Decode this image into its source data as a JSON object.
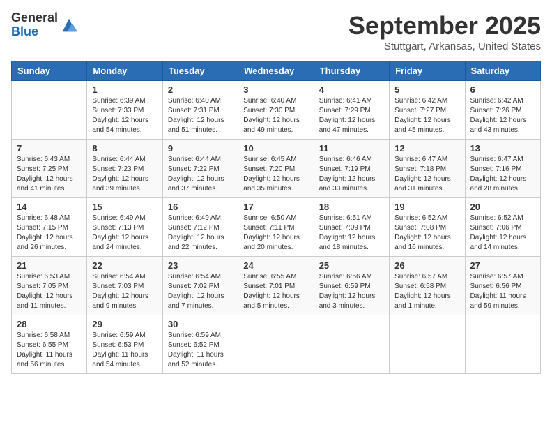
{
  "logo": {
    "general": "General",
    "blue": "Blue"
  },
  "header": {
    "month": "September 2025",
    "location": "Stuttgart, Arkansas, United States"
  },
  "weekdays": [
    "Sunday",
    "Monday",
    "Tuesday",
    "Wednesday",
    "Thursday",
    "Friday",
    "Saturday"
  ],
  "weeks": [
    [
      {
        "day": "",
        "sunrise": "",
        "sunset": "",
        "daylight": ""
      },
      {
        "day": "1",
        "sunrise": "Sunrise: 6:39 AM",
        "sunset": "Sunset: 7:33 PM",
        "daylight": "Daylight: 12 hours and 54 minutes."
      },
      {
        "day": "2",
        "sunrise": "Sunrise: 6:40 AM",
        "sunset": "Sunset: 7:31 PM",
        "daylight": "Daylight: 12 hours and 51 minutes."
      },
      {
        "day": "3",
        "sunrise": "Sunrise: 6:40 AM",
        "sunset": "Sunset: 7:30 PM",
        "daylight": "Daylight: 12 hours and 49 minutes."
      },
      {
        "day": "4",
        "sunrise": "Sunrise: 6:41 AM",
        "sunset": "Sunset: 7:29 PM",
        "daylight": "Daylight: 12 hours and 47 minutes."
      },
      {
        "day": "5",
        "sunrise": "Sunrise: 6:42 AM",
        "sunset": "Sunset: 7:27 PM",
        "daylight": "Daylight: 12 hours and 45 minutes."
      },
      {
        "day": "6",
        "sunrise": "Sunrise: 6:42 AM",
        "sunset": "Sunset: 7:26 PM",
        "daylight": "Daylight: 12 hours and 43 minutes."
      }
    ],
    [
      {
        "day": "7",
        "sunrise": "Sunrise: 6:43 AM",
        "sunset": "Sunset: 7:25 PM",
        "daylight": "Daylight: 12 hours and 41 minutes."
      },
      {
        "day": "8",
        "sunrise": "Sunrise: 6:44 AM",
        "sunset": "Sunset: 7:23 PM",
        "daylight": "Daylight: 12 hours and 39 minutes."
      },
      {
        "day": "9",
        "sunrise": "Sunrise: 6:44 AM",
        "sunset": "Sunset: 7:22 PM",
        "daylight": "Daylight: 12 hours and 37 minutes."
      },
      {
        "day": "10",
        "sunrise": "Sunrise: 6:45 AM",
        "sunset": "Sunset: 7:20 PM",
        "daylight": "Daylight: 12 hours and 35 minutes."
      },
      {
        "day": "11",
        "sunrise": "Sunrise: 6:46 AM",
        "sunset": "Sunset: 7:19 PM",
        "daylight": "Daylight: 12 hours and 33 minutes."
      },
      {
        "day": "12",
        "sunrise": "Sunrise: 6:47 AM",
        "sunset": "Sunset: 7:18 PM",
        "daylight": "Daylight: 12 hours and 31 minutes."
      },
      {
        "day": "13",
        "sunrise": "Sunrise: 6:47 AM",
        "sunset": "Sunset: 7:16 PM",
        "daylight": "Daylight: 12 hours and 28 minutes."
      }
    ],
    [
      {
        "day": "14",
        "sunrise": "Sunrise: 6:48 AM",
        "sunset": "Sunset: 7:15 PM",
        "daylight": "Daylight: 12 hours and 26 minutes."
      },
      {
        "day": "15",
        "sunrise": "Sunrise: 6:49 AM",
        "sunset": "Sunset: 7:13 PM",
        "daylight": "Daylight: 12 hours and 24 minutes."
      },
      {
        "day": "16",
        "sunrise": "Sunrise: 6:49 AM",
        "sunset": "Sunset: 7:12 PM",
        "daylight": "Daylight: 12 hours and 22 minutes."
      },
      {
        "day": "17",
        "sunrise": "Sunrise: 6:50 AM",
        "sunset": "Sunset: 7:11 PM",
        "daylight": "Daylight: 12 hours and 20 minutes."
      },
      {
        "day": "18",
        "sunrise": "Sunrise: 6:51 AM",
        "sunset": "Sunset: 7:09 PM",
        "daylight": "Daylight: 12 hours and 18 minutes."
      },
      {
        "day": "19",
        "sunrise": "Sunrise: 6:52 AM",
        "sunset": "Sunset: 7:08 PM",
        "daylight": "Daylight: 12 hours and 16 minutes."
      },
      {
        "day": "20",
        "sunrise": "Sunrise: 6:52 AM",
        "sunset": "Sunset: 7:06 PM",
        "daylight": "Daylight: 12 hours and 14 minutes."
      }
    ],
    [
      {
        "day": "21",
        "sunrise": "Sunrise: 6:53 AM",
        "sunset": "Sunset: 7:05 PM",
        "daylight": "Daylight: 12 hours and 11 minutes."
      },
      {
        "day": "22",
        "sunrise": "Sunrise: 6:54 AM",
        "sunset": "Sunset: 7:03 PM",
        "daylight": "Daylight: 12 hours and 9 minutes."
      },
      {
        "day": "23",
        "sunrise": "Sunrise: 6:54 AM",
        "sunset": "Sunset: 7:02 PM",
        "daylight": "Daylight: 12 hours and 7 minutes."
      },
      {
        "day": "24",
        "sunrise": "Sunrise: 6:55 AM",
        "sunset": "Sunset: 7:01 PM",
        "daylight": "Daylight: 12 hours and 5 minutes."
      },
      {
        "day": "25",
        "sunrise": "Sunrise: 6:56 AM",
        "sunset": "Sunset: 6:59 PM",
        "daylight": "Daylight: 12 hours and 3 minutes."
      },
      {
        "day": "26",
        "sunrise": "Sunrise: 6:57 AM",
        "sunset": "Sunset: 6:58 PM",
        "daylight": "Daylight: 12 hours and 1 minute."
      },
      {
        "day": "27",
        "sunrise": "Sunrise: 6:57 AM",
        "sunset": "Sunset: 6:56 PM",
        "daylight": "Daylight: 11 hours and 59 minutes."
      }
    ],
    [
      {
        "day": "28",
        "sunrise": "Sunrise: 6:58 AM",
        "sunset": "Sunset: 6:55 PM",
        "daylight": "Daylight: 11 hours and 56 minutes."
      },
      {
        "day": "29",
        "sunrise": "Sunrise: 6:59 AM",
        "sunset": "Sunset: 6:53 PM",
        "daylight": "Daylight: 11 hours and 54 minutes."
      },
      {
        "day": "30",
        "sunrise": "Sunrise: 6:59 AM",
        "sunset": "Sunset: 6:52 PM",
        "daylight": "Daylight: 11 hours and 52 minutes."
      },
      {
        "day": "",
        "sunrise": "",
        "sunset": "",
        "daylight": ""
      },
      {
        "day": "",
        "sunrise": "",
        "sunset": "",
        "daylight": ""
      },
      {
        "day": "",
        "sunrise": "",
        "sunset": "",
        "daylight": ""
      },
      {
        "day": "",
        "sunrise": "",
        "sunset": "",
        "daylight": ""
      }
    ]
  ]
}
